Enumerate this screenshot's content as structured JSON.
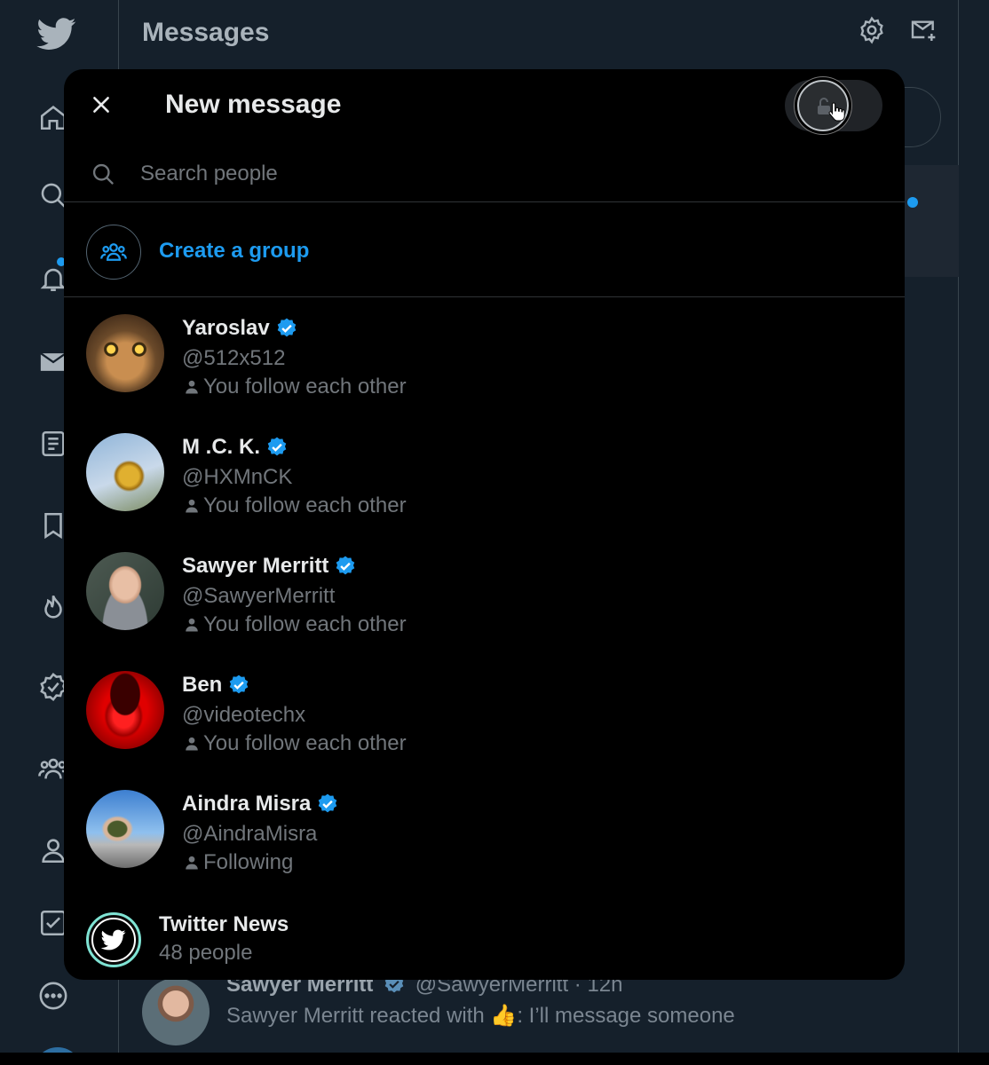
{
  "background": {
    "title": "Messages",
    "conversation": {
      "name": "Sawyer Merritt",
      "meta": "@SawyerMerritt · 12h",
      "preview_prefix": "Sawyer Merritt reacted with ",
      "preview_emoji": "👍",
      "preview_suffix": ": I’ll message someone"
    }
  },
  "modal": {
    "title": "New message",
    "search": {
      "placeholder": "Search people",
      "value": ""
    },
    "create_group_label": "Create a group",
    "people": [
      {
        "name": "Yaroslav",
        "handle": "@512x512",
        "status": "You follow each other",
        "verified": true
      },
      {
        "name": "M .C. K.",
        "handle": "@HXMnCK",
        "status": "You follow each other",
        "verified": true
      },
      {
        "name": "Sawyer Merritt",
        "handle": "@SawyerMerritt",
        "status": "You follow each other",
        "verified": true
      },
      {
        "name": "Ben",
        "handle": "@videotechx",
        "status": "You follow each other",
        "verified": true
      },
      {
        "name": "Aindra Misra",
        "handle": "@AindraMisra",
        "status": "Following",
        "verified": true
      }
    ],
    "group": {
      "name": "Twitter News",
      "count": "48 people"
    }
  },
  "colors": {
    "accent": "#1d9bf0",
    "background": "#15202b",
    "modal_background": "#000000",
    "muted_text": "#71767b"
  },
  "icons": {
    "logo": "twitter-bird-icon",
    "sidebar": [
      "home-icon",
      "explore-icon",
      "bell-icon",
      "mail-icon",
      "lists-icon",
      "bookmark-icon",
      "flame-icon",
      "verified-badge-icon",
      "communities-icon",
      "profile-icon",
      "checklist-icon",
      "more-icon"
    ],
    "header": [
      "gear-icon",
      "new-message-icon"
    ],
    "modal": [
      "close-icon",
      "lock-icon",
      "search-icon",
      "group-icon",
      "verified-icon",
      "person-icon"
    ]
  }
}
